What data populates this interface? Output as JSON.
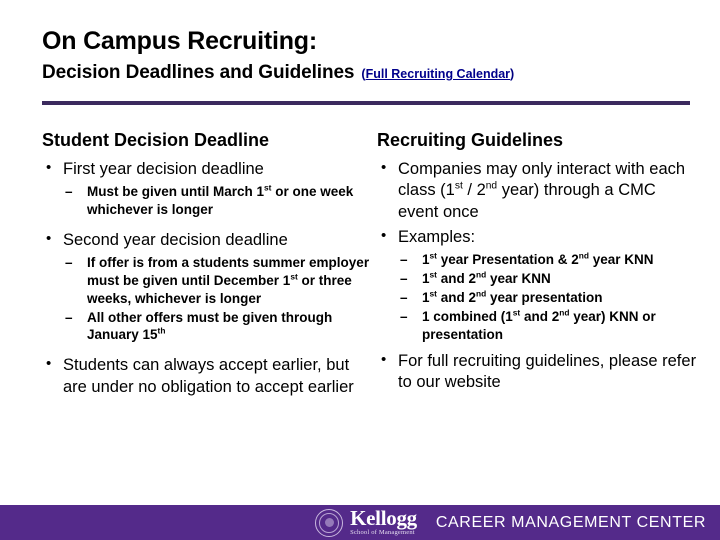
{
  "slide": {
    "title_main": "On Campus Recruiting:",
    "title_sub": "Decision Deadlines and Guidelines",
    "link_open_paren": "(",
    "link_text": "Full Recruiting Calendar",
    "link_close_paren": ")",
    "accent_color": "#3B2A5E",
    "link_color": "#00008B",
    "footer_color": "#542A8A"
  },
  "left_column": {
    "heading": "Student Decision Deadline",
    "bullets": [
      {
        "text": "First year decision deadline",
        "sub": [
          {
            "pre": "Must be given until March 1",
            "sup": "st",
            "post": " or one week whichever is longer"
          }
        ]
      },
      {
        "text": "Second year decision deadline",
        "sub": [
          {
            "pre": "If offer is from a students summer employer must be given until December 1",
            "sup": "st",
            "post": " or three weeks, whichever is longer"
          },
          {
            "pre": "All other offers must be given through January 15",
            "sup": "th",
            "post": ""
          }
        ]
      },
      {
        "text": "Students can always accept earlier, but are under no obligation to accept earlier",
        "sub": []
      }
    ]
  },
  "right_column": {
    "heading": "Recruiting Guidelines",
    "bullet1_part1": "Companies may only interact with each class (1",
    "bullet1_sup1": "st",
    "bullet1_part2": " / 2",
    "bullet1_sup2": "nd",
    "bullet1_part3": " year) through a CMC event once",
    "bullet2": "Examples:",
    "examples": [
      {
        "p1": "1",
        "s1": "st",
        "p2": " year Presentation & 2",
        "s2": "nd",
        "p3": " year KNN"
      },
      {
        "p1": "1",
        "s1": "st",
        "p2": " and 2",
        "s2": "nd",
        "p3": " year KNN"
      },
      {
        "p1": "1",
        "s1": "st",
        "p2": " and 2",
        "s2": "nd",
        "p3": " year presentation"
      },
      {
        "p1": "1 combined (1",
        "s1": "st",
        "p2": " and 2",
        "s2": "nd",
        "p3": " year) KNN or presentation"
      }
    ],
    "bullet3": "For full recruiting guidelines, please refer to our website"
  },
  "footer": {
    "brand_word": "Kellogg",
    "brand_tagline": "School of Management",
    "cmc_label": "CAREER MANAGEMENT CENTER"
  }
}
